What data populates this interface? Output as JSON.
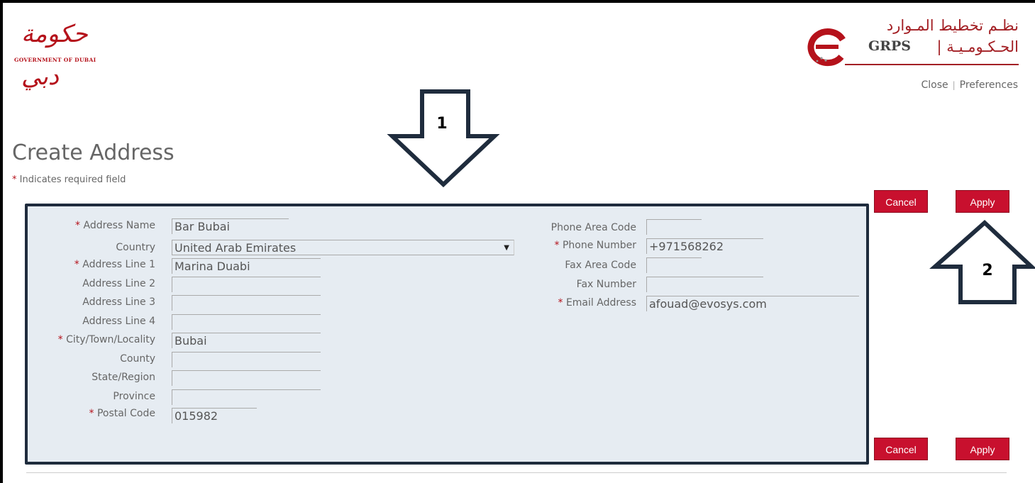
{
  "header": {
    "gov_logo_arabic": "حكومة دبي",
    "gov_logo_english": "GOVERNMENT OF DUBAI",
    "grps_arabic_line1": "نظـم تخطيط المـوارد",
    "grps_latin": "GRPS",
    "grps_arabic_line2": "| الحـكـومـيـة",
    "links": {
      "close": "Close",
      "separator": "|",
      "preferences": "Preferences"
    }
  },
  "page": {
    "title": "Create Address",
    "required_star": "*",
    "required_note": " Indicates required field"
  },
  "buttons": {
    "cancel": "Cancel",
    "apply": "Apply"
  },
  "form": {
    "left": [
      {
        "label": "Address Name",
        "required": "*",
        "value": "Bar Bubai"
      },
      {
        "label": "Country",
        "required": "",
        "value": "United Arab Emirates"
      },
      {
        "label": "Address Line 1",
        "required": "*",
        "value": "Marina Duabi"
      },
      {
        "label": "Address Line 2",
        "required": "",
        "value": ""
      },
      {
        "label": "Address Line 3",
        "required": "",
        "value": ""
      },
      {
        "label": "Address Line 4",
        "required": "",
        "value": ""
      },
      {
        "label": "City/Town/Locality",
        "required": "*",
        "value": "Bubai"
      },
      {
        "label": "County",
        "required": "",
        "value": ""
      },
      {
        "label": "State/Region",
        "required": "",
        "value": ""
      },
      {
        "label": "Province",
        "required": "",
        "value": ""
      },
      {
        "label": "Postal Code",
        "required": "*",
        "value": "015982"
      }
    ],
    "right": [
      {
        "label": "Phone Area Code",
        "required": "",
        "value": ""
      },
      {
        "label": "Phone Number",
        "required": "*",
        "value": "+971568262"
      },
      {
        "label": "Fax Area Code",
        "required": "",
        "value": ""
      },
      {
        "label": "Fax Number",
        "required": "",
        "value": ""
      },
      {
        "label": "Email Address",
        "required": "*",
        "value": "afouad@evosys.com"
      }
    ]
  },
  "annotations": {
    "arrow1": "1",
    "arrow2": "2"
  },
  "colors": {
    "accent_red": "#c8102e",
    "panel_bg": "#e6ecf2",
    "panel_border": "#1f2c3d",
    "arrow": "#1f2c3d"
  },
  "icons": [
    "dropdown-caret-icon",
    "down-arrow-annotation-icon",
    "up-arrow-annotation-icon",
    "grps-e-logo-icon"
  ]
}
